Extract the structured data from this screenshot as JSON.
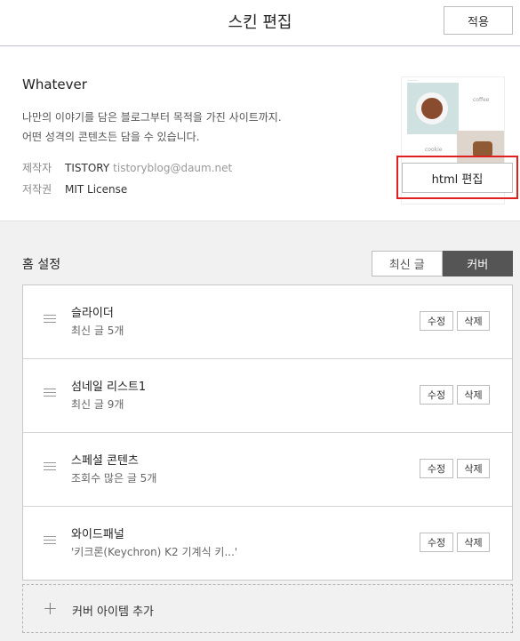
{
  "header": {
    "title": "스킨 편집",
    "apply_label": "적용"
  },
  "skin": {
    "name": "Whatever",
    "desc_line1": "나만의 이야기를 담은 블로그부터 목적을 가진 사이트까지.",
    "desc_line2": "어떤 성격의 콘텐츠든 담을 수 있습니다.",
    "author_key": "제작자",
    "author_value": "TISTORY",
    "author_email": "tistoryblog@daum.net",
    "license_key": "저작권",
    "license_value": "MIT License",
    "html_edit_label": "html 편집",
    "thumb_text_1": "coffee",
    "thumb_text_2": "cookie"
  },
  "home": {
    "label": "홈 설정",
    "tabs": [
      "최신 글",
      "커버"
    ],
    "active_tab": "커버",
    "items": [
      {
        "title": "슬라이더",
        "sub": "최신 글 5개",
        "edit": "수정",
        "delete": "삭제"
      },
      {
        "title": "섬네일 리스트1",
        "sub": "최신 글 9개",
        "edit": "수정",
        "delete": "삭제"
      },
      {
        "title": "스페셜 콘텐츠",
        "sub": "조회수 많은 글 5개",
        "edit": "수정",
        "delete": "삭제"
      },
      {
        "title": "와이드패널",
        "sub": "'키크론(Keychron) K2 기계식 키...'",
        "edit": "수정",
        "delete": "삭제"
      }
    ],
    "add_label": "커버 아이템 추가",
    "add_icon": "+"
  },
  "colors": {
    "highlight": "#e02020",
    "active_tab_bg": "#555555"
  }
}
